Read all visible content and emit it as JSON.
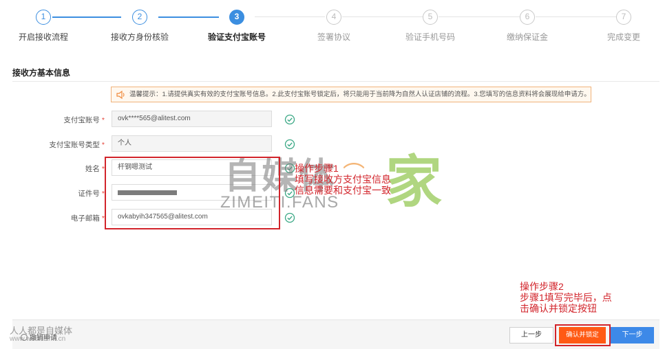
{
  "stepper": {
    "steps": [
      {
        "num": "1",
        "label": "开启接收流程"
      },
      {
        "num": "2",
        "label": "接收方身份核验"
      },
      {
        "num": "3",
        "label": "验证支付宝账号"
      },
      {
        "num": "4",
        "label": "签署协议"
      },
      {
        "num": "5",
        "label": "验证手机号码"
      },
      {
        "num": "6",
        "label": "缴纳保证金"
      },
      {
        "num": "7",
        "label": "完成变更"
      }
    ],
    "current_step": 3
  },
  "section": {
    "title": "接收方基本信息",
    "notice": "温馨提示：1.请提供真实有效的支付宝账号信息。2.此支付宝账号锁定后，将只能用于当前降为自然人认证店铺的流程。3.您填写的信息资料将会展现给申请方。"
  },
  "form": {
    "required_mark": "*",
    "alipay_account": {
      "label": "支付宝账号",
      "value": "ovk****565@alitest.com"
    },
    "account_type": {
      "label": "支付宝账号类型",
      "value": "个人"
    },
    "name": {
      "label": "姓名",
      "value": "杆钢嗯测试"
    },
    "id_number": {
      "label": "证件号",
      "value": ""
    },
    "email": {
      "label": "电子邮箱",
      "value": "ovkabyih347565@alitest.com"
    }
  },
  "annotations": {
    "step1": {
      "line1": "操作步骤1",
      "line2": "填写接收方支付宝信息",
      "line3": "信息需要和支付宝一致"
    },
    "step2": {
      "line1": "操作步骤2",
      "line2": "步骤1填写完毕后，点",
      "line3": "击确认并锁定按钮"
    }
  },
  "watermark": {
    "main": "自媒体",
    "home": "家",
    "sub": "ZIMEITI.FANS",
    "corner_line1": "人人都是自媒体",
    "corner_line2": "www.woshizimt.cn"
  },
  "footer": {
    "withdraw": "撤销申请",
    "prev": "上一步",
    "confirm": "确认并锁定",
    "next": "下一步"
  },
  "colors": {
    "primary": "#3b8ee0",
    "confirm": "#ff5a14",
    "annotation": "#d2232a",
    "success": "#3aa885"
  }
}
